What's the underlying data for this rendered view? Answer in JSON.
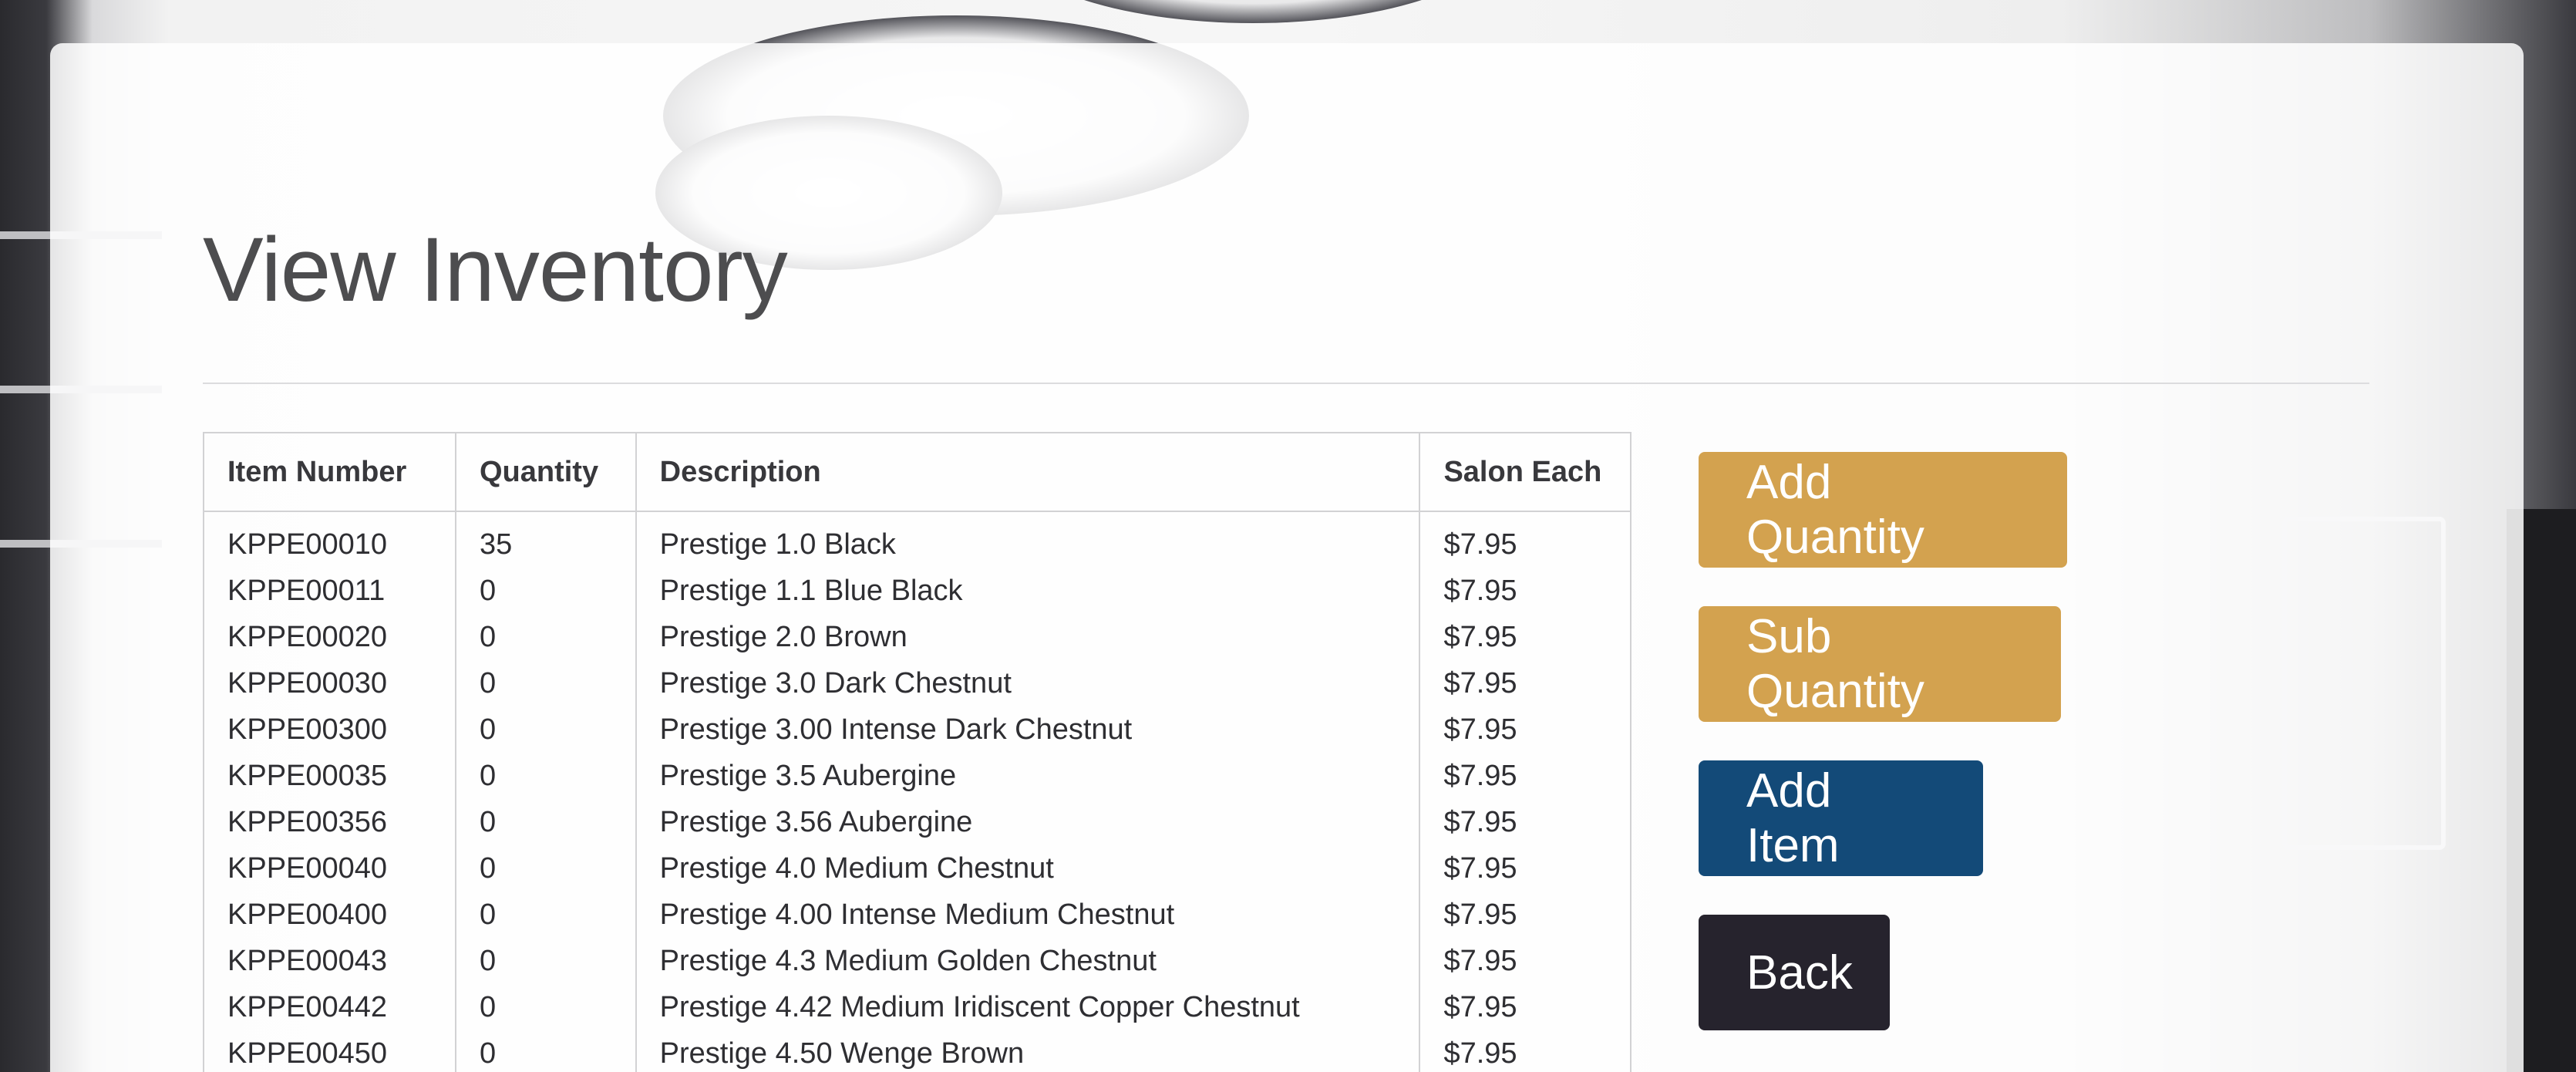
{
  "page": {
    "title": "View Inventory"
  },
  "table": {
    "headers": [
      "Item Number",
      "Quantity",
      "Description",
      "Salon Each"
    ],
    "rows": [
      [
        "KPPE00010",
        "35",
        "Prestige 1.0 Black",
        "$7.95"
      ],
      [
        "KPPE00011",
        "0",
        "Prestige 1.1 Blue Black",
        "$7.95"
      ],
      [
        "KPPE00020",
        "0",
        "Prestige 2.0 Brown",
        "$7.95"
      ],
      [
        "KPPE00030",
        "0",
        "Prestige 3.0 Dark Chestnut",
        "$7.95"
      ],
      [
        "KPPE00300",
        "0",
        "Prestige 3.00 Intense Dark Chestnut",
        "$7.95"
      ],
      [
        "KPPE00035",
        "0",
        "Prestige 3.5 Aubergine",
        "$7.95"
      ],
      [
        "KPPE00356",
        "0",
        "Prestige 3.56 Aubergine",
        "$7.95"
      ],
      [
        "KPPE00040",
        "0",
        "Prestige 4.0 Medium Chestnut",
        "$7.95"
      ],
      [
        "KPPE00400",
        "0",
        "Prestige 4.00 Intense Medium Chestnut",
        "$7.95"
      ],
      [
        "KPPE00043",
        "0",
        "Prestige 4.3 Medium Golden Chestnut",
        "$7.95"
      ],
      [
        "KPPE00442",
        "0",
        "Prestige 4.42 Medium Iridiscent Copper Chestnut",
        "$7.95"
      ],
      [
        "KPPE00450",
        "0",
        "Prestige 4.50 Wenge Brown",
        "$7.95"
      ]
    ]
  },
  "actions": {
    "add_quantity": "Add Quantity",
    "sub_quantity": "Sub Quantity",
    "add_item": "Add Item",
    "back": "Back"
  },
  "colors": {
    "gold_button": "#d3a24f",
    "blue_button": "#134a78",
    "dark_button": "#26232d",
    "title_text": "#4d4d4f"
  }
}
